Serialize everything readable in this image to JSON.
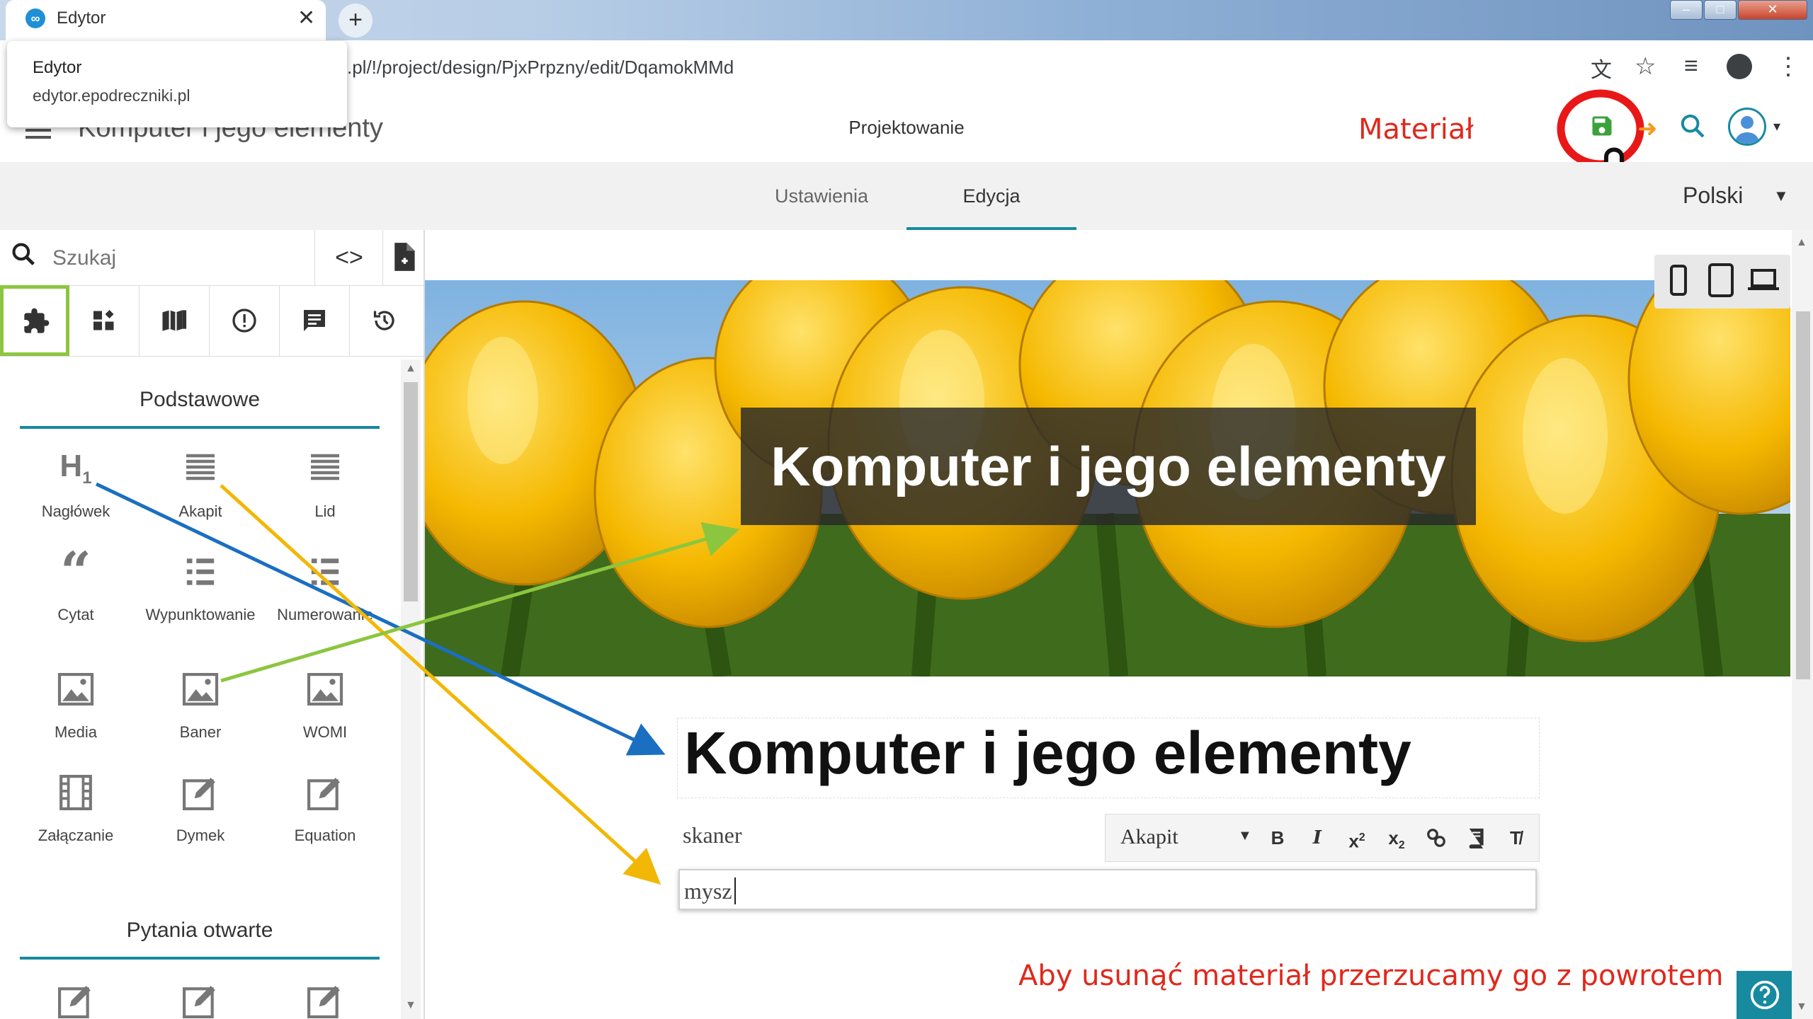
{
  "browser": {
    "tab_title": "Edytor",
    "url": ".pl/!/project/design/PjxPrpzny/edit/DqamokMMd",
    "tooltip_title": "Edytor",
    "tooltip_url": "edytor.epodreczniki.pl"
  },
  "header": {
    "doc_title": "Komputer i jego elementy",
    "main_tab": "Projektowanie",
    "annotation_label": "Materiał"
  },
  "subnav": {
    "settings": "Ustawienia",
    "edit": "Edycja",
    "language": "Polski"
  },
  "sidebar": {
    "search_placeholder": "Szukaj",
    "section_basic": "Podstawowe",
    "widgets": [
      "Nagłówek",
      "Akapit",
      "Lid",
      "Cytat",
      "Wypunktowanie",
      "Numerowanie",
      "Media",
      "Baner",
      "WOMI",
      "Załączanie",
      "Dymek",
      "Equation"
    ],
    "section_open": "Pytania otwarte"
  },
  "canvas": {
    "banner_title": "Komputer i jego elementy",
    "heading": "Komputer i jego elementy",
    "para1": "skaner",
    "para2": "mysz",
    "format_select": "Akapit"
  },
  "annotation": {
    "hint": "Aby usunąć materiał przerzucamy go z powrotem"
  },
  "colors": {
    "accent": "#178aa0",
    "annotation_red": "#e0281c",
    "highlight_green": "#8cc63f",
    "arrow_blue": "#1a6fc0",
    "arrow_yellow": "#f2b705",
    "arrow_green": "#8cc63f",
    "save_green": "#3aa23a"
  }
}
